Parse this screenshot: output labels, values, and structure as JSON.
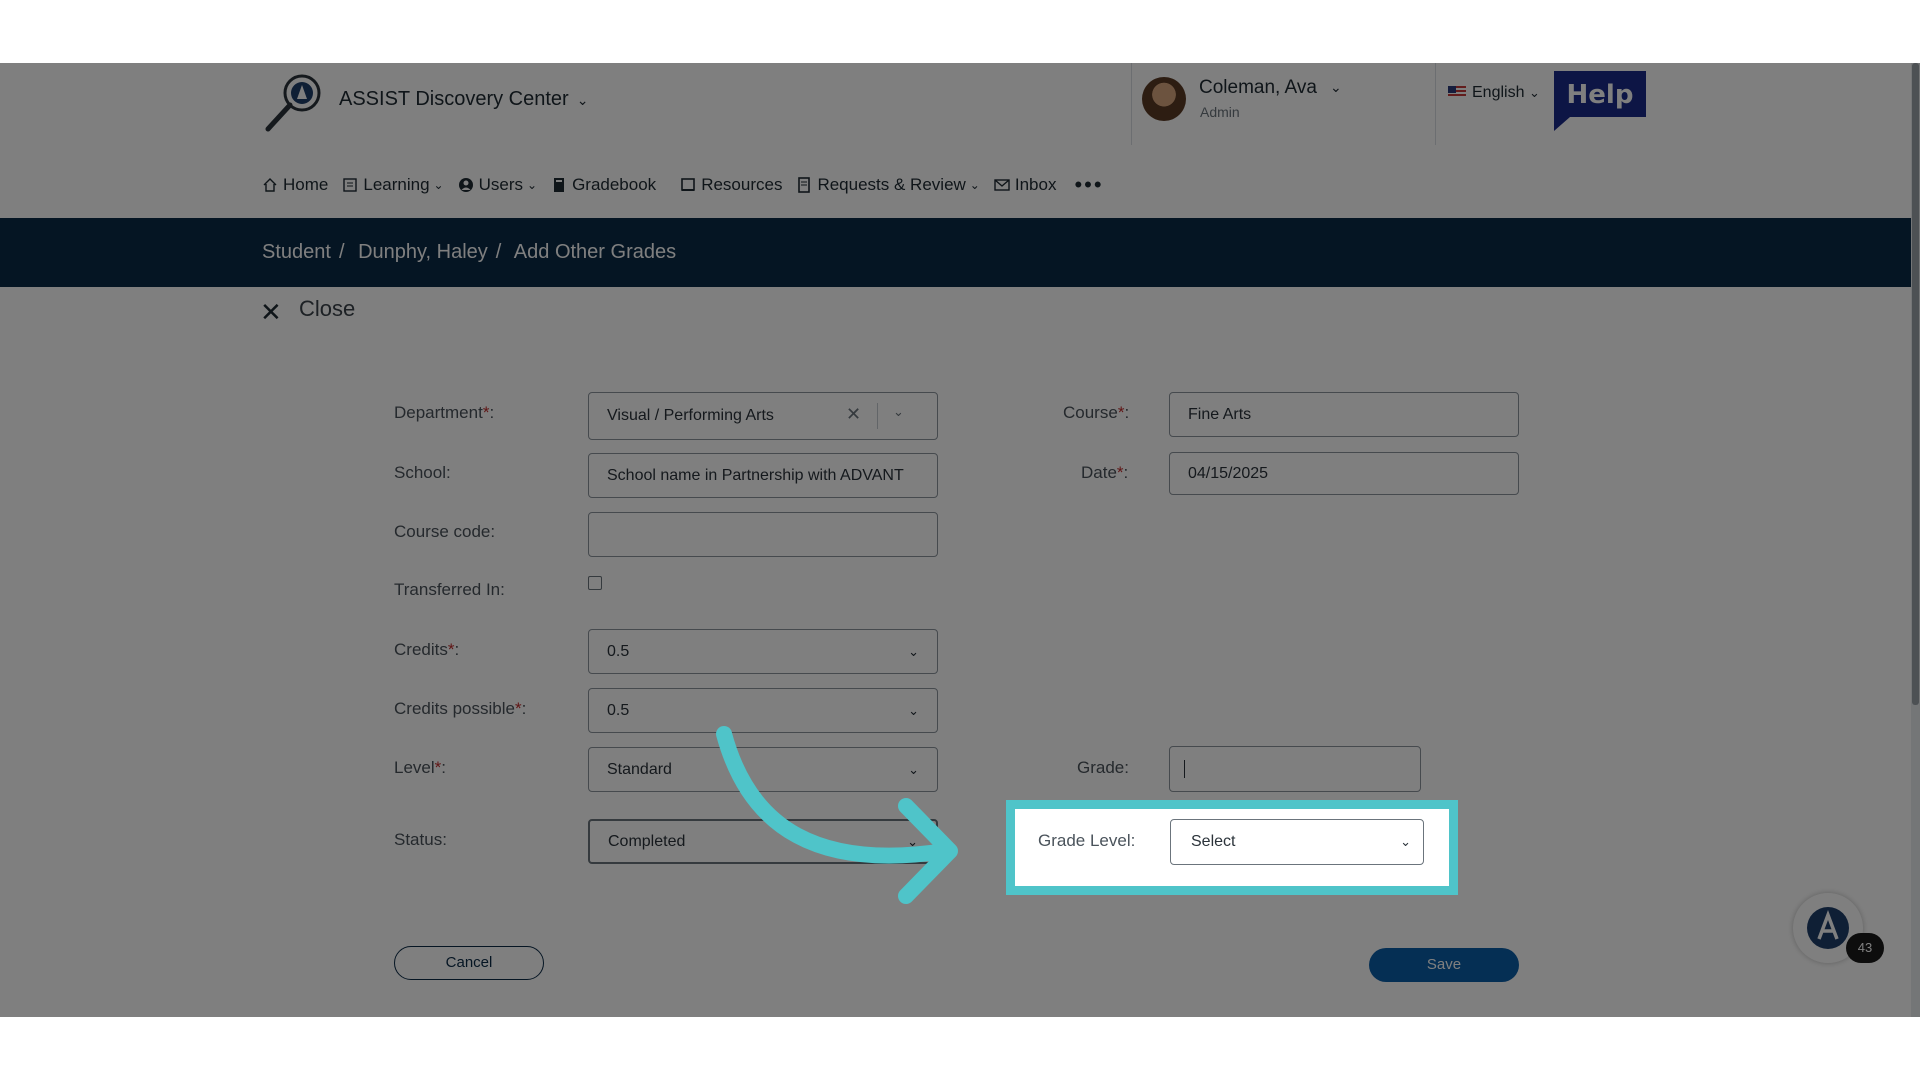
{
  "header": {
    "app_title": "ASSIST Discovery Center",
    "user_name": "Coleman, Ava",
    "user_role": "Admin",
    "language": "English",
    "help_label": "Help"
  },
  "nav": [
    {
      "label": "Home",
      "icon": "home-icon",
      "dropdown": false
    },
    {
      "label": "Learning",
      "icon": "learning-icon",
      "dropdown": true
    },
    {
      "label": "Users",
      "icon": "users-icon",
      "dropdown": true
    },
    {
      "label": "Gradebook",
      "icon": "gradebook-icon",
      "dropdown": false
    },
    {
      "label": "Resources",
      "icon": "resources-icon",
      "dropdown": false
    },
    {
      "label": "Requests & Review",
      "icon": "requests-icon",
      "dropdown": true
    },
    {
      "label": "Inbox",
      "icon": "inbox-icon",
      "dropdown": false
    }
  ],
  "breadcrumb": {
    "items": [
      "Student",
      "Dunphy, Haley",
      "Add Other Grades"
    ],
    "separator": "/"
  },
  "close_label": "Close",
  "form": {
    "department_label": "Department",
    "department_value": "Visual / Performing Arts",
    "school_label": "School",
    "school_value": "School name in Partnership with ADVANT",
    "course_code_label": "Course code",
    "course_code_value": "",
    "transferred_label": "Transferred In",
    "transferred_checked": false,
    "credits_label": "Credits",
    "credits_value": "0.5",
    "credits_possible_label": "Credits possible",
    "credits_possible_value": "0.5",
    "level_label": "Level",
    "level_value": "Standard",
    "status_label": "Status",
    "status_value": "Completed",
    "course_label": "Course",
    "course_value": "Fine Arts",
    "date_label": "Date",
    "date_value": "04/15/2025",
    "grade_label": "Grade",
    "grade_value": "",
    "grade_level_label": "Grade Level",
    "grade_level_value": "Select",
    "required_mark": "*",
    "colon": ":"
  },
  "buttons": {
    "cancel": "Cancel",
    "save": "Save"
  },
  "chat_badge": "43",
  "colors": {
    "accent_dark": "#0b2a47",
    "save_blue": "#0b5ea8",
    "highlight": "#4fc4c9",
    "required_red": "#c02a2a"
  }
}
